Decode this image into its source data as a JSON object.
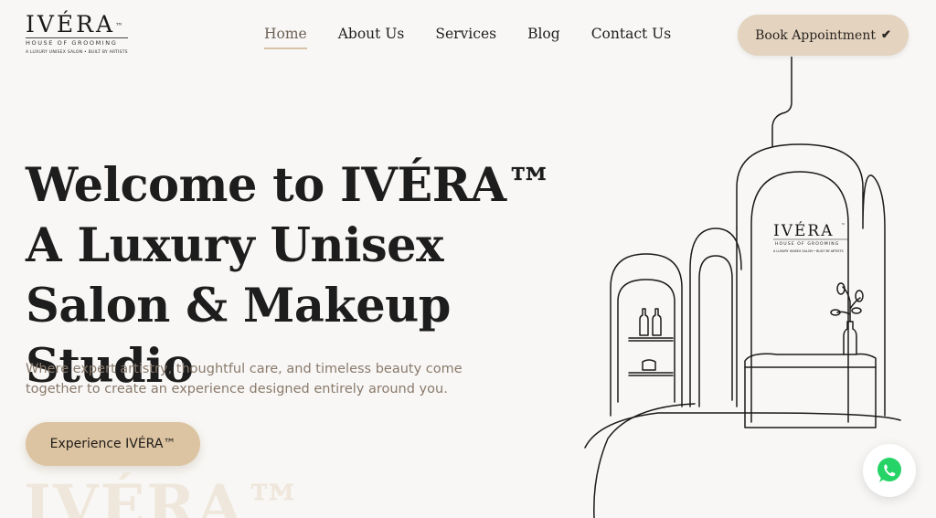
{
  "logo": {
    "word": "IVÉRA",
    "tm": "™",
    "sub": "HOUSE OF GROOMING",
    "tagline": "A LUXURY UNISEX SALON • BUILT BY ARTISTS"
  },
  "nav": {
    "items": [
      "Home",
      "About Us",
      "Services",
      "Blog",
      "Contact Us"
    ],
    "active": "Home"
  },
  "header": {
    "book_label": "Book Appointment",
    "book_icon": "check-icon"
  },
  "hero": {
    "title": "Welcome to IVÉRA™ A Luxury Unisex Salon & Makeup Studio",
    "subtitle": "Where expert artistry, thoughtful care, and timeless beauty come together to create an experience designed entirely around you.",
    "cta_label": "Experience IVÉRA™",
    "watermark": "IVÉRA™"
  },
  "illustration": {
    "sign_word": "IVÉRA",
    "sign_tm": "™",
    "sign_sub": "HOUSE OF GROOMING",
    "sign_tag": "A LUXURY UNISEX SALON • BUILT BY ARTISTS"
  },
  "floating": {
    "icon": "whatsapp-icon"
  },
  "colors": {
    "background": "#f8f7f5",
    "accent": "#dcc4a2",
    "accent_light": "#e3d3bf",
    "subtitle_text": "#8a7a6c",
    "whatsapp_green": "#25d366"
  }
}
